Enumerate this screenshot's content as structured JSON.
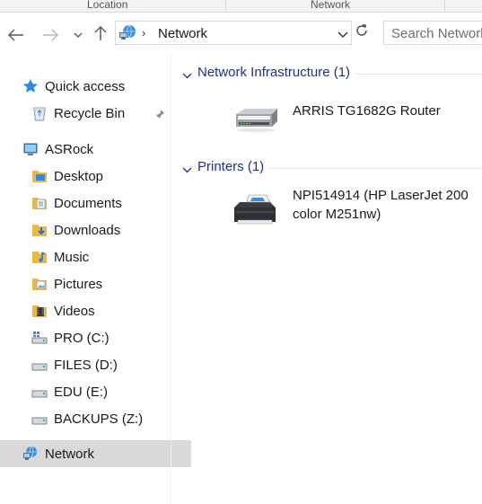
{
  "ribbon": {
    "groups": [
      "Location",
      "Network"
    ]
  },
  "address": {
    "location": "Network",
    "search_placeholder": "Search Network"
  },
  "nav": {
    "quick_access": "Quick access",
    "recycle_bin": "Recycle Bin",
    "this_pc": "ASRock",
    "items": [
      "Desktop",
      "Documents",
      "Downloads",
      "Music",
      "Pictures",
      "Videos"
    ],
    "drives": [
      "PRO (C:)",
      "FILES (D:)",
      "EDU (E:)",
      "BACKUPS (Z:)"
    ],
    "network": "Network"
  },
  "content": {
    "groups": [
      {
        "title": "Network Infrastructure (1)",
        "items": [
          {
            "name": "ARRIS TG1682G Router",
            "icon": "router-icon"
          }
        ]
      },
      {
        "title": "Printers (1)",
        "items": [
          {
            "name": "NPI514914 (HP LaserJet 200 color M251nw)",
            "icon": "printer-icon"
          }
        ]
      }
    ]
  },
  "colors": {
    "group_title": "#1e3287",
    "selected_bg": "#d9d9d9",
    "folder": "#e8b84a"
  }
}
